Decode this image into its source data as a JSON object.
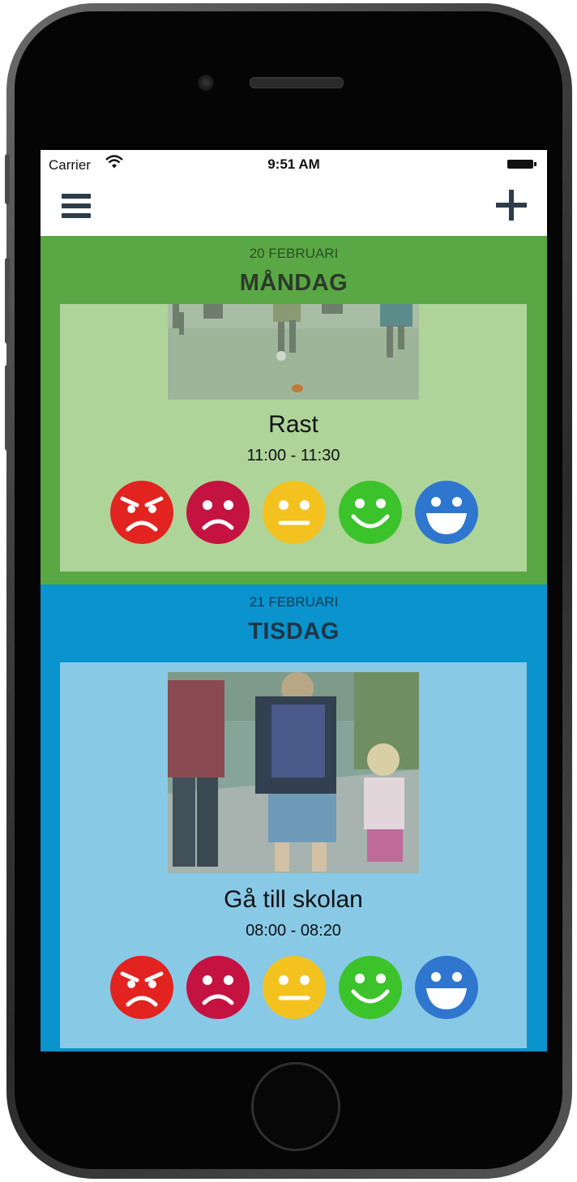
{
  "status_bar": {
    "carrier": "Carrier",
    "time": "9:51 AM"
  },
  "nav": {
    "menu_icon": "hamburger-menu-icon",
    "add_icon": "plus-icon"
  },
  "days": [
    {
      "date": "20 FEBRUARI",
      "weekday": "MÅNDAG",
      "color": "#5aa845",
      "activity": {
        "title": "Rast",
        "time": "11:00 - 11:30"
      }
    },
    {
      "date": "21 FEBRUARI",
      "weekday": "TISDAG",
      "color": "#0a93cd",
      "activity": {
        "title": "Gå till skolan",
        "time": "08:00 - 08:20"
      }
    }
  ],
  "moods": [
    {
      "name": "angry",
      "color": "#e2231f"
    },
    {
      "name": "sad",
      "color": "#c41241"
    },
    {
      "name": "neutral",
      "color": "#f4c21f"
    },
    {
      "name": "happy",
      "color": "#3cc32b"
    },
    {
      "name": "very-happy",
      "color": "#2f76cf"
    }
  ]
}
